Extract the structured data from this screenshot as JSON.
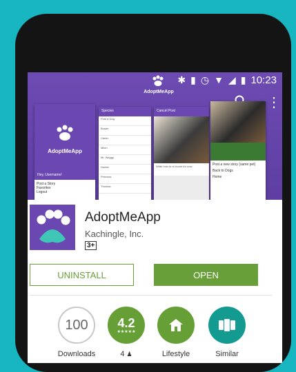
{
  "status_bar": {
    "time": "10:23"
  },
  "hero": {
    "logo_text": "AdoptMeApp",
    "shot1": {
      "app_title": "AdoptMeApp",
      "greeting": "Hey, Username!",
      "menu": [
        "Post a Story",
        "Favorites",
        "Logout"
      ]
    },
    "shot2": {
      "bar_title": "Species",
      "rows": [
        "Post a Dog",
        "Buster",
        "Carter",
        "Mitch",
        "Mr. Waggy",
        "Hunter",
        "Princess",
        "Thomas"
      ]
    },
    "shot3": {
      "bar_title": "Cancel Post",
      "caption": "Write how to re-home for now"
    },
    "shot4": {
      "menu": [
        "Post a new story (same pet)",
        "Back to Dogs",
        "Home"
      ]
    }
  },
  "app": {
    "name": "AdoptMeApp",
    "developer": "Kachingle, Inc.",
    "content_rating": "3+"
  },
  "buttons": {
    "uninstall": "UNINSTALL",
    "open": "OPEN"
  },
  "stats": {
    "downloads": {
      "value": "100",
      "label": "Downloads"
    },
    "rating": {
      "value": "4.2",
      "count_label": "4"
    },
    "category": {
      "label": "Lifestyle",
      "icon": "home-icon"
    },
    "similar": {
      "label": "Similar",
      "icon": "cards-icon"
    }
  },
  "colors": {
    "brand_purple": "#6a47b1",
    "accent_green": "#689f38",
    "teal": "#139a91",
    "background": "#17b6c0"
  }
}
